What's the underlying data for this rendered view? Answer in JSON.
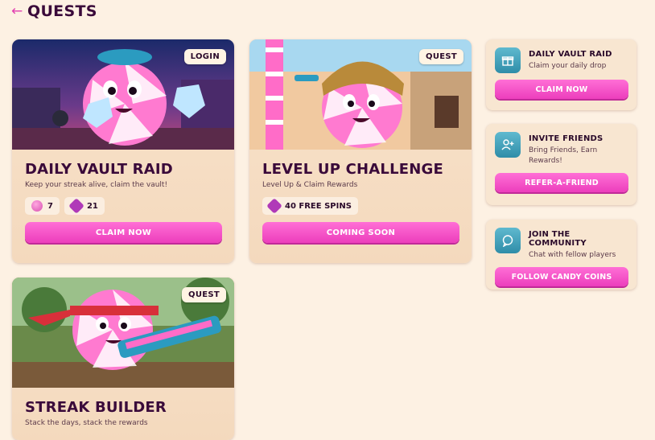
{
  "header": {
    "title": "QUESTS",
    "back_icon": "back-arrow-icon"
  },
  "colors": {
    "background": "#fdf1e3",
    "accent_pink": "#ec3ebc",
    "title_purple": "#3a0a3a",
    "icon_teal": "#2f8da8"
  },
  "quests": [
    {
      "badge": "LOGIN",
      "title": "DAILY VAULT RAID",
      "subtitle": "Keep your streak alive, claim the vault!",
      "stats": [
        {
          "icon": "candy-coin-icon",
          "value": "7"
        },
        {
          "icon": "spin-icon",
          "value": "21"
        }
      ],
      "button": "CLAIM NOW"
    },
    {
      "badge": "QUEST",
      "title": "LEVEL UP CHALLENGE",
      "subtitle": "Level Up & Claim Rewards",
      "stats": [
        {
          "icon": "spin-icon",
          "value": "40 FREE SPINS"
        }
      ],
      "button": "COMING SOON"
    },
    {
      "badge": "QUEST",
      "title": "STREAK BUILDER",
      "subtitle": "Stack the days, stack the rewards"
    }
  ],
  "side": [
    {
      "icon": "gift-icon",
      "title": "DAILY VAULT RAID",
      "subtitle": "Claim your daily drop",
      "button": "CLAIM NOW"
    },
    {
      "icon": "add-user-icon",
      "title": "INVITE FRIENDS",
      "subtitle": "Bring Friends, Earn Rewards!",
      "button": "REFER-A-FRIEND"
    },
    {
      "icon": "chat-icon",
      "title": "JOIN THE COMMUNITY",
      "subtitle": "Chat with fellow players",
      "button": "FOLLOW CANDY COINS"
    }
  ]
}
